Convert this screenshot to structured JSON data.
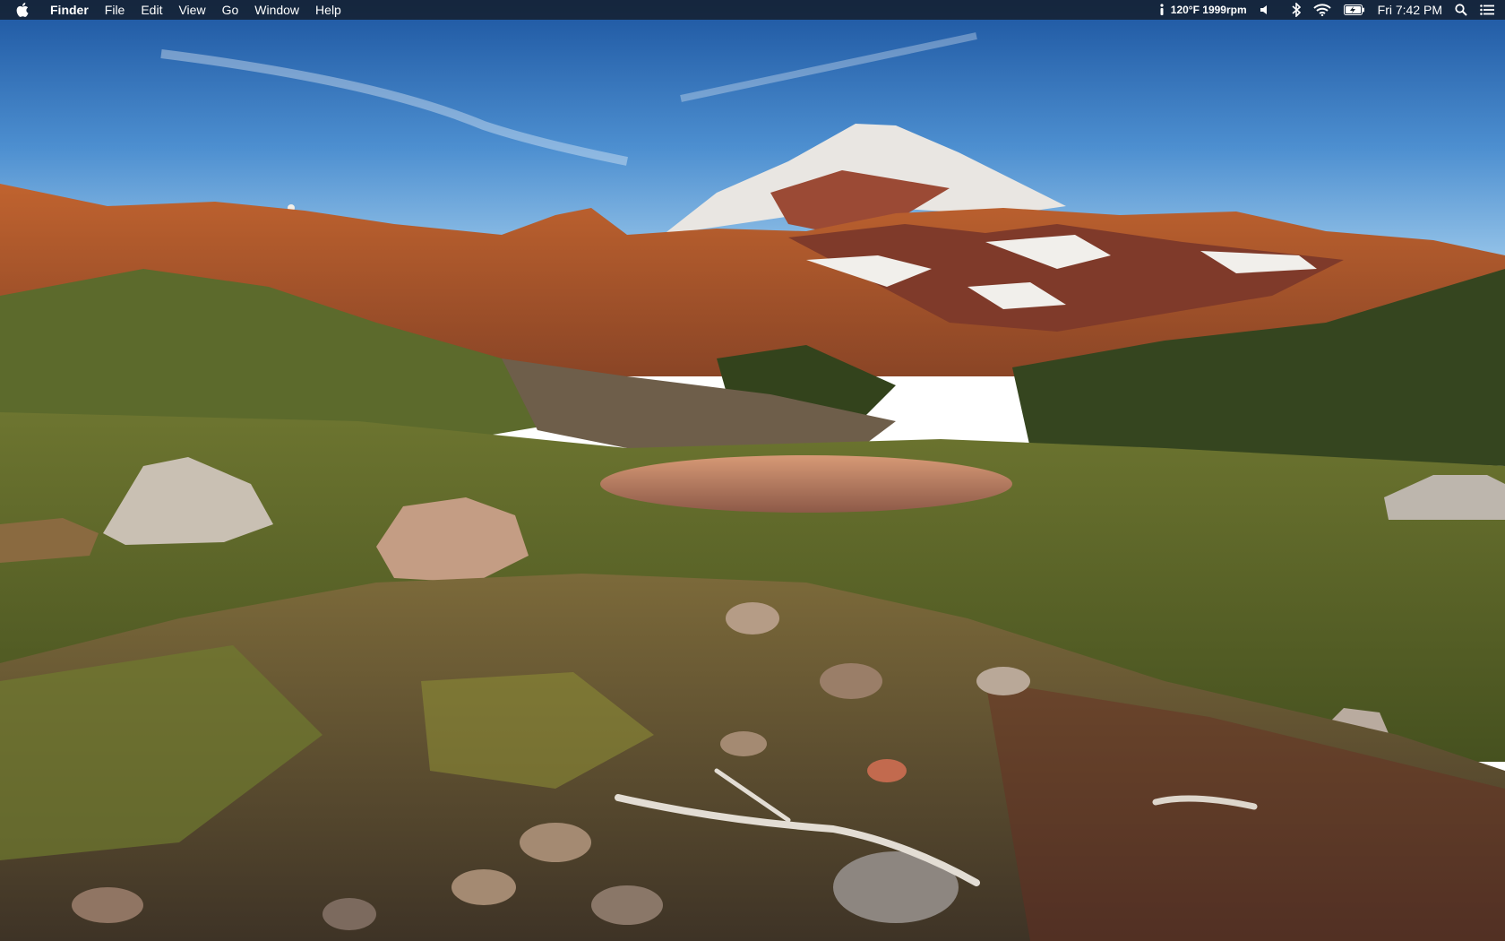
{
  "menubar": {
    "apple_icon": "apple-logo-icon",
    "app_name": "Finder",
    "menus": [
      "File",
      "Edit",
      "View",
      "Go",
      "Window",
      "Help"
    ],
    "status": {
      "sensor_text": "120°F 1999rpm",
      "clock": "Fri 7:42 PM",
      "icons": [
        "info-icon",
        "volume-icon",
        "bluetooth-icon",
        "wifi-icon",
        "battery-charging-icon",
        "spotlight-search-icon",
        "notification-center-icon"
      ]
    }
  },
  "wallpaper": {
    "subject": "alpine meadow with snow-capped mountain and tarn at sunset",
    "colors": {
      "sky_top": "#1f5fa8",
      "sky_horizon": "#8fc2e8",
      "ridge": "#b8562c",
      "meadow": "#5d6b2a",
      "snow": "#f4f2ee"
    }
  }
}
